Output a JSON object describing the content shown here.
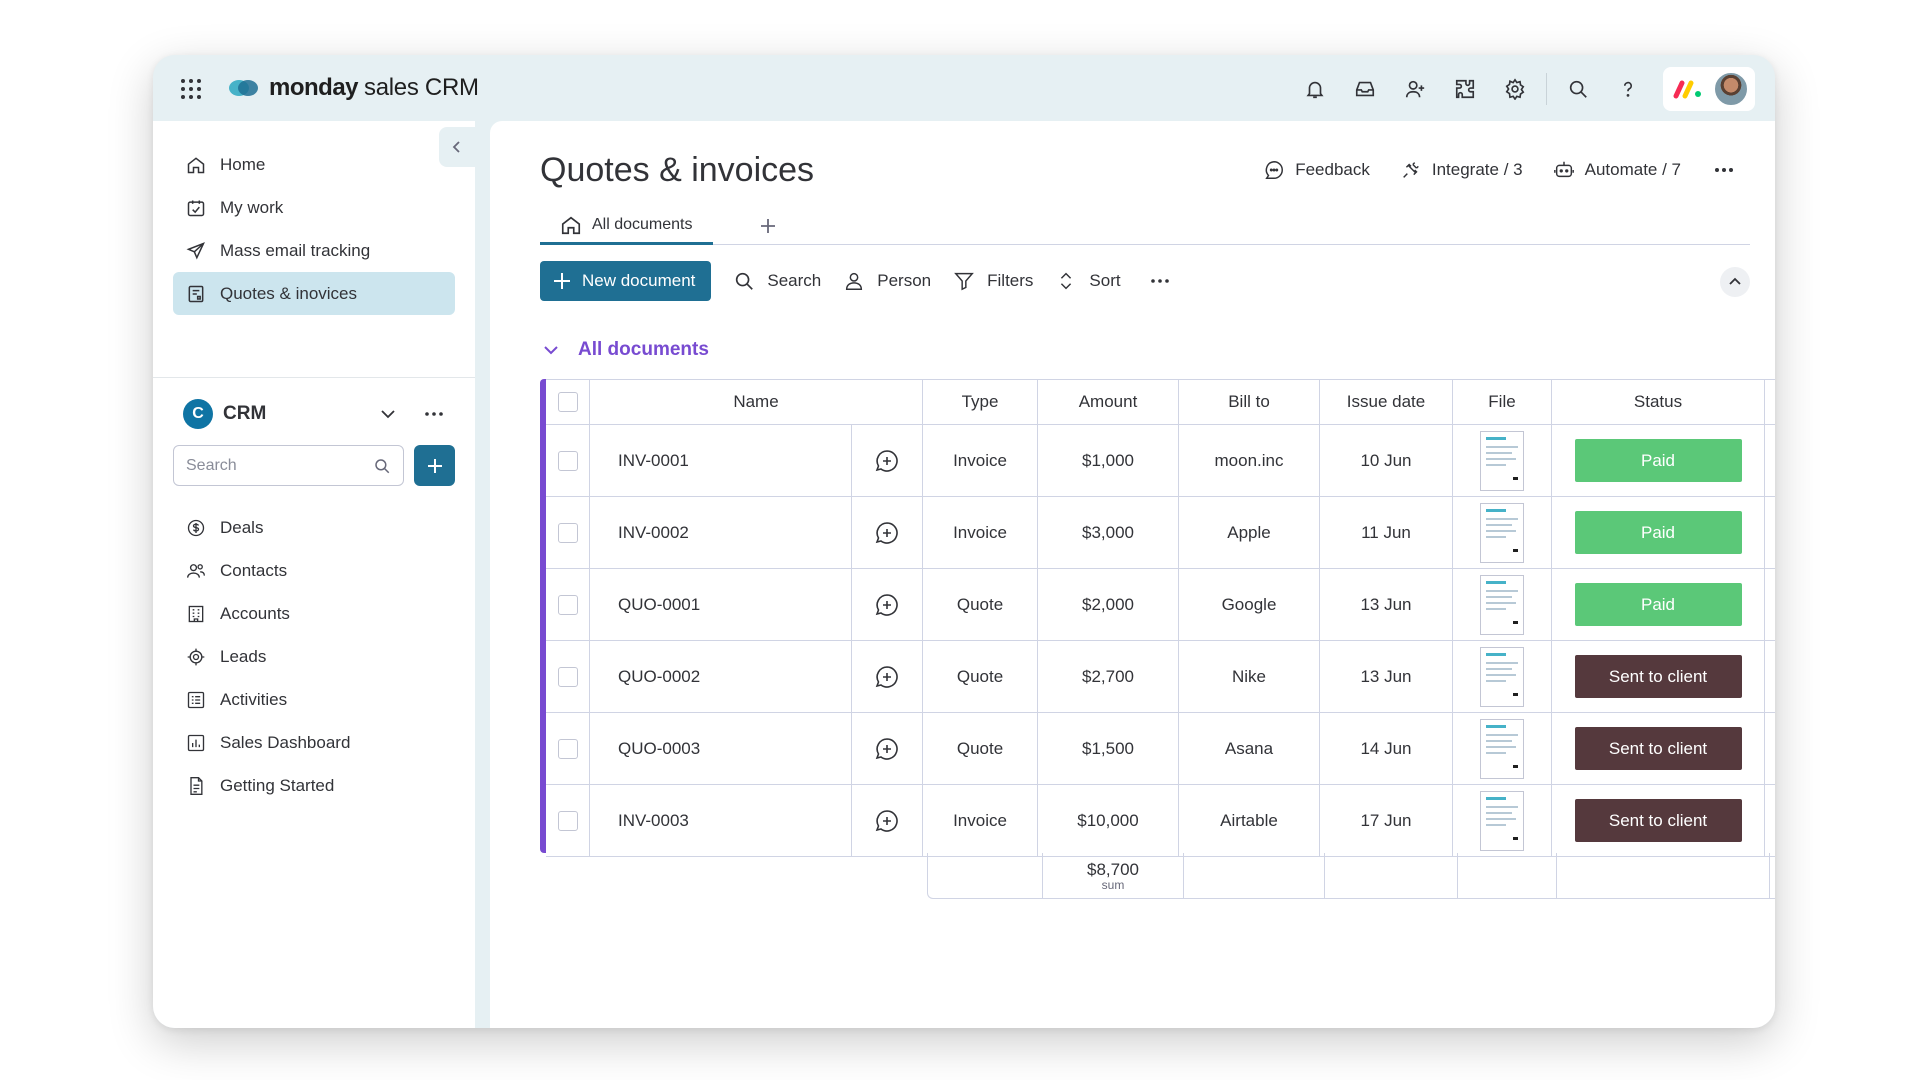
{
  "app": {
    "brand": "monday",
    "product": "sales CRM"
  },
  "sidebar": {
    "nav": [
      {
        "label": "Home",
        "icon": "home-icon"
      },
      {
        "label": "My work",
        "icon": "calendar-check-icon"
      },
      {
        "label": "Mass email tracking",
        "icon": "paper-plane-icon"
      },
      {
        "label": "Quotes & inovices",
        "icon": "quote-doc-icon",
        "active": true
      }
    ],
    "workspace": {
      "badge": "C",
      "name": "CRM"
    },
    "search_placeholder": "Search",
    "items": [
      {
        "label": "Deals",
        "icon": "dollar-icon"
      },
      {
        "label": "Contacts",
        "icon": "contacts-icon"
      },
      {
        "label": "Accounts",
        "icon": "building-icon"
      },
      {
        "label": "Leads",
        "icon": "target-icon"
      },
      {
        "label": "Activities",
        "icon": "list-icon"
      },
      {
        "label": "Sales Dashboard",
        "icon": "chart-icon"
      },
      {
        "label": "Getting Started",
        "icon": "document-icon"
      }
    ]
  },
  "main": {
    "title": "Quotes & invoices",
    "actions": {
      "feedback": "Feedback",
      "integrate": "Integrate / 3",
      "automate": "Automate / 7"
    },
    "tab": "All documents",
    "toolbar": {
      "new_document": "New document",
      "search": "Search",
      "person": "Person",
      "filters": "Filters",
      "sort": "Sort"
    },
    "group_title": "All documents"
  },
  "table": {
    "columns": {
      "name": "Name",
      "type": "Type",
      "amount": "Amount",
      "bill_to": "Bill to",
      "issue_date": "Issue date",
      "file": "File",
      "status": "Status"
    },
    "rows": [
      {
        "name": "INV-0001",
        "type": "Invoice",
        "amount": "$1,000",
        "bill_to": "moon.inc",
        "issue_date": "10 Jun",
        "status": "Paid"
      },
      {
        "name": "INV-0002",
        "type": "Invoice",
        "amount": "$3,000",
        "bill_to": "Apple",
        "issue_date": "11 Jun",
        "status": "Paid"
      },
      {
        "name": "QUO-0001",
        "type": "Quote",
        "amount": "$2,000",
        "bill_to": "Google",
        "issue_date": "13 Jun",
        "status": "Paid"
      },
      {
        "name": "QUO-0002",
        "type": "Quote",
        "amount": "$2,700",
        "bill_to": "Nike",
        "issue_date": "13 Jun",
        "status": "Sent to client"
      },
      {
        "name": "QUO-0003",
        "type": "Quote",
        "amount": "$1,500",
        "bill_to": "Asana",
        "issue_date": "14 Jun",
        "status": "Sent to client"
      },
      {
        "name": "INV-0003",
        "type": "Invoice",
        "amount": "$10,000",
        "bill_to": "Airtable",
        "issue_date": "17 Jun",
        "status": "Sent to client"
      }
    ],
    "summary": {
      "amount": "$8,700",
      "label": "sum"
    }
  },
  "colors": {
    "accent": "#1f6f93",
    "group": "#784bd1",
    "status_paid": "#5bc878",
    "status_sent": "#55393d",
    "active_nav": "#cce5ee"
  }
}
